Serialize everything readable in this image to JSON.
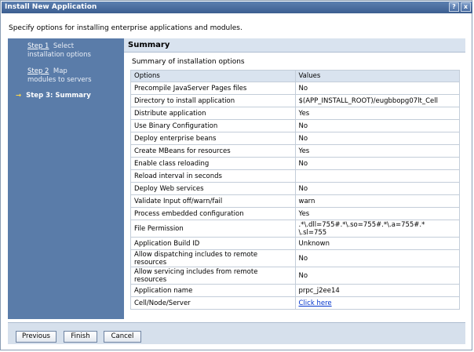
{
  "window": {
    "title": "Install New Application",
    "help_glyph": "?",
    "close_glyph": "x"
  },
  "instructions": "Specify options for installing enterprise applications and modules.",
  "steps": [
    {
      "link": "Step 1",
      "text1": "Select",
      "text2": "installation options"
    },
    {
      "link": "Step 2",
      "text1": "Map",
      "text2": "modules to servers"
    },
    {
      "arrow": "→",
      "label": "Step 3: Summary"
    }
  ],
  "summary": {
    "header": "Summary",
    "caption": "Summary of installation options",
    "col_options": "Options",
    "col_values": "Values",
    "rows": [
      {
        "option": "Precompile JavaServer Pages files",
        "value": "No"
      },
      {
        "option": "Directory to install application",
        "value": "$(APP_INSTALL_ROOT)/eugbbopg07lt_Cell"
      },
      {
        "option": "Distribute application",
        "value": "Yes"
      },
      {
        "option": "Use Binary Configuration",
        "value": "No"
      },
      {
        "option": "Deploy enterprise beans",
        "value": "No"
      },
      {
        "option": "Create MBeans for resources",
        "value": "Yes"
      },
      {
        "option": "Enable class reloading",
        "value": "No"
      },
      {
        "option": "Reload interval in seconds",
        "value": ""
      },
      {
        "option": "Deploy Web services",
        "value": "No"
      },
      {
        "option": "Validate Input off/warn/fail",
        "value": "warn"
      },
      {
        "option": "Process embedded configuration",
        "value": "Yes"
      },
      {
        "option": "File Permission",
        "value_line1": ".*\\.dll=755#.*\\.so=755#.*\\.a=755#.*",
        "value_line2": "\\.sl=755"
      },
      {
        "option": "Application Build ID",
        "value": "Unknown"
      },
      {
        "option_line1": "Allow dispatching includes to remote",
        "option_line2": "resources",
        "value": "No"
      },
      {
        "option_line1": "Allow servicing includes from remote",
        "option_line2": "resources",
        "value": "No"
      },
      {
        "option": "Application name",
        "value": "prpc_j2ee14"
      },
      {
        "option": "Cell/Node/Server",
        "value": "Click here"
      }
    ]
  },
  "buttons": {
    "previous": "Previous",
    "finish": "Finish",
    "cancel": "Cancel"
  }
}
